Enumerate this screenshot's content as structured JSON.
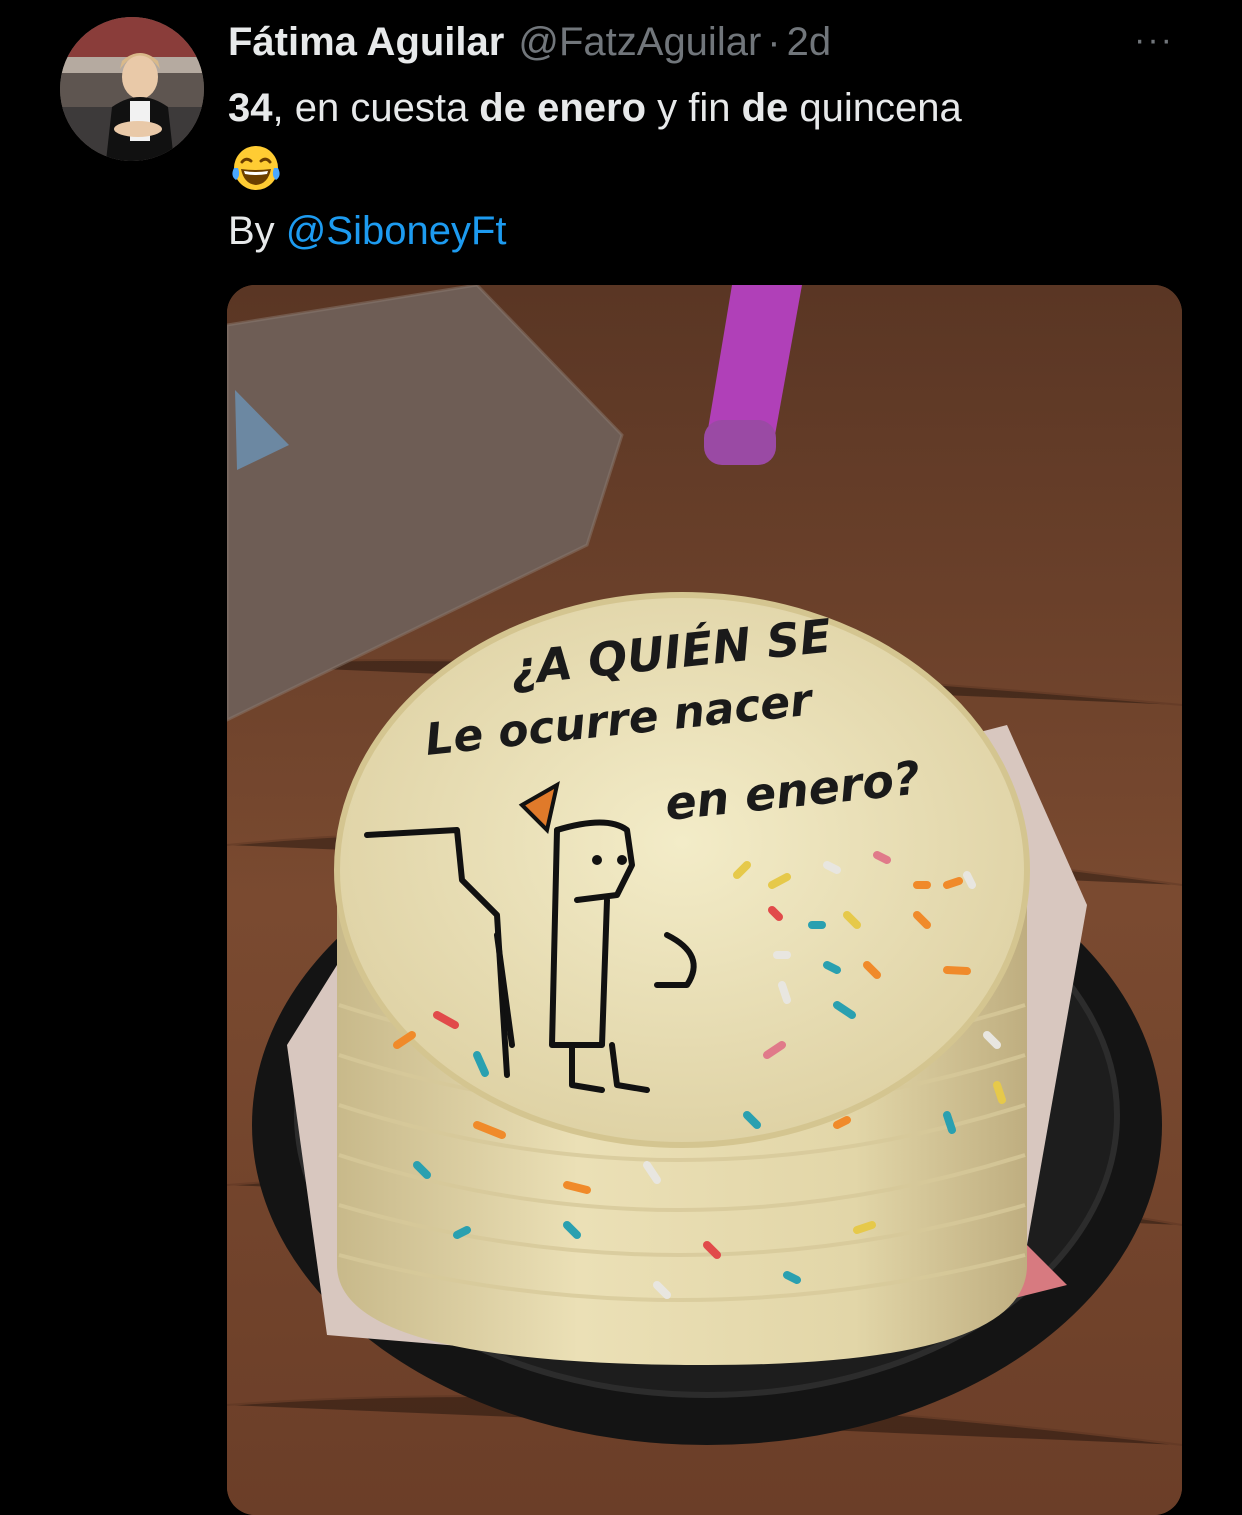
{
  "tweet": {
    "author": {
      "display_name": "Fátima Aguilar",
      "handle": "@FatzAguilar",
      "separator": "·",
      "timestamp": "2d"
    },
    "more_label": "···",
    "text": {
      "part1": "34",
      "part2": ", en cuesta ",
      "part3": "de enero",
      "part4": " y fin ",
      "part5": "de",
      "part6": " quincena"
    },
    "emoji": "face-with-tears-of-joy",
    "byline": {
      "prefix": "By ",
      "mention": "@SiboneyFt"
    },
    "media": {
      "cake_text_line1": "¿A QUIÉN SE",
      "cake_text_line2": "Le ocurre nacer",
      "cake_text_line3": "en enero?"
    }
  },
  "colors": {
    "background": "#000000",
    "text_primary": "#e7e9ea",
    "text_secondary": "#71767b",
    "link": "#1d9bf0"
  }
}
